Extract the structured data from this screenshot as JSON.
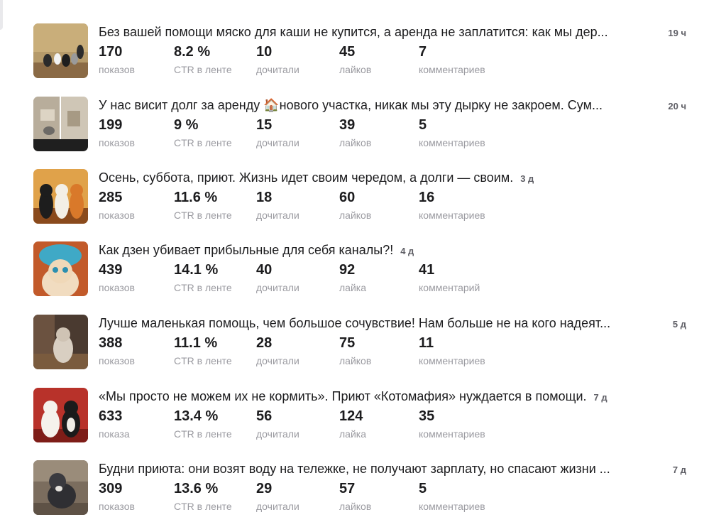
{
  "posts": [
    {
      "title": "Без вашей помощи мяско для каши не купится, а аренда не заплатится: как мы дер...",
      "age": "19 ч",
      "stats": [
        {
          "value": "170",
          "label": "показов"
        },
        {
          "value": "8.2 %",
          "label": "CTR в ленте"
        },
        {
          "value": "10",
          "label": "дочитали"
        },
        {
          "value": "45",
          "label": "лайков"
        },
        {
          "value": "7",
          "label": "комментариев"
        }
      ]
    },
    {
      "title": "У нас висит долг за аренду 🏠нового участка, никак мы эту дырку не закроем. Сум...",
      "age": "20 ч",
      "stats": [
        {
          "value": "199",
          "label": "показов"
        },
        {
          "value": "9 %",
          "label": "CTR в ленте"
        },
        {
          "value": "15",
          "label": "дочитали"
        },
        {
          "value": "39",
          "label": "лайков"
        },
        {
          "value": "5",
          "label": "комментариев"
        }
      ]
    },
    {
      "title": "Осень, суббота, приют. Жизнь идет своим чередом, а долги — своим.",
      "age": "3 д",
      "stats": [
        {
          "value": "285",
          "label": "показов"
        },
        {
          "value": "11.6 %",
          "label": "CTR в ленте"
        },
        {
          "value": "18",
          "label": "дочитали"
        },
        {
          "value": "60",
          "label": "лайков"
        },
        {
          "value": "16",
          "label": "комментариев"
        }
      ]
    },
    {
      "title": "Как дзен убивает прибыльные для себя каналы?!",
      "age": "4 д",
      "stats": [
        {
          "value": "439",
          "label": "показов"
        },
        {
          "value": "14.1 %",
          "label": "CTR в ленте"
        },
        {
          "value": "40",
          "label": "дочитали"
        },
        {
          "value": "92",
          "label": "лайка"
        },
        {
          "value": "41",
          "label": "комментарий"
        }
      ]
    },
    {
      "title": "Лучше маленькая помощь, чем большое сочувствие! Нам больше не на кого надеят...",
      "age": "5 д",
      "stats": [
        {
          "value": "388",
          "label": "показов"
        },
        {
          "value": "11.1 %",
          "label": "CTR в ленте"
        },
        {
          "value": "28",
          "label": "дочитали"
        },
        {
          "value": "75",
          "label": "лайков"
        },
        {
          "value": "11",
          "label": "комментариев"
        }
      ]
    },
    {
      "title": "«Мы просто не можем их не кормить». Приют «Котомафия» нуждается в помощи.",
      "age": "7 д",
      "stats": [
        {
          "value": "633",
          "label": "показа"
        },
        {
          "value": "13.4 %",
          "label": "CTR в ленте"
        },
        {
          "value": "56",
          "label": "дочитали"
        },
        {
          "value": "124",
          "label": "лайка"
        },
        {
          "value": "35",
          "label": "комментариев"
        }
      ]
    },
    {
      "title": "Будни приюта: они возят воду на тележке, не получают зарплату, но спасают жизни ...",
      "age": "7 д",
      "stats": [
        {
          "value": "309",
          "label": "показов"
        },
        {
          "value": "13.6 %",
          "label": "CTR в ленте"
        },
        {
          "value": "29",
          "label": "дочитали"
        },
        {
          "value": "57",
          "label": "лайков"
        },
        {
          "value": "5",
          "label": "комментариев"
        }
      ]
    }
  ]
}
